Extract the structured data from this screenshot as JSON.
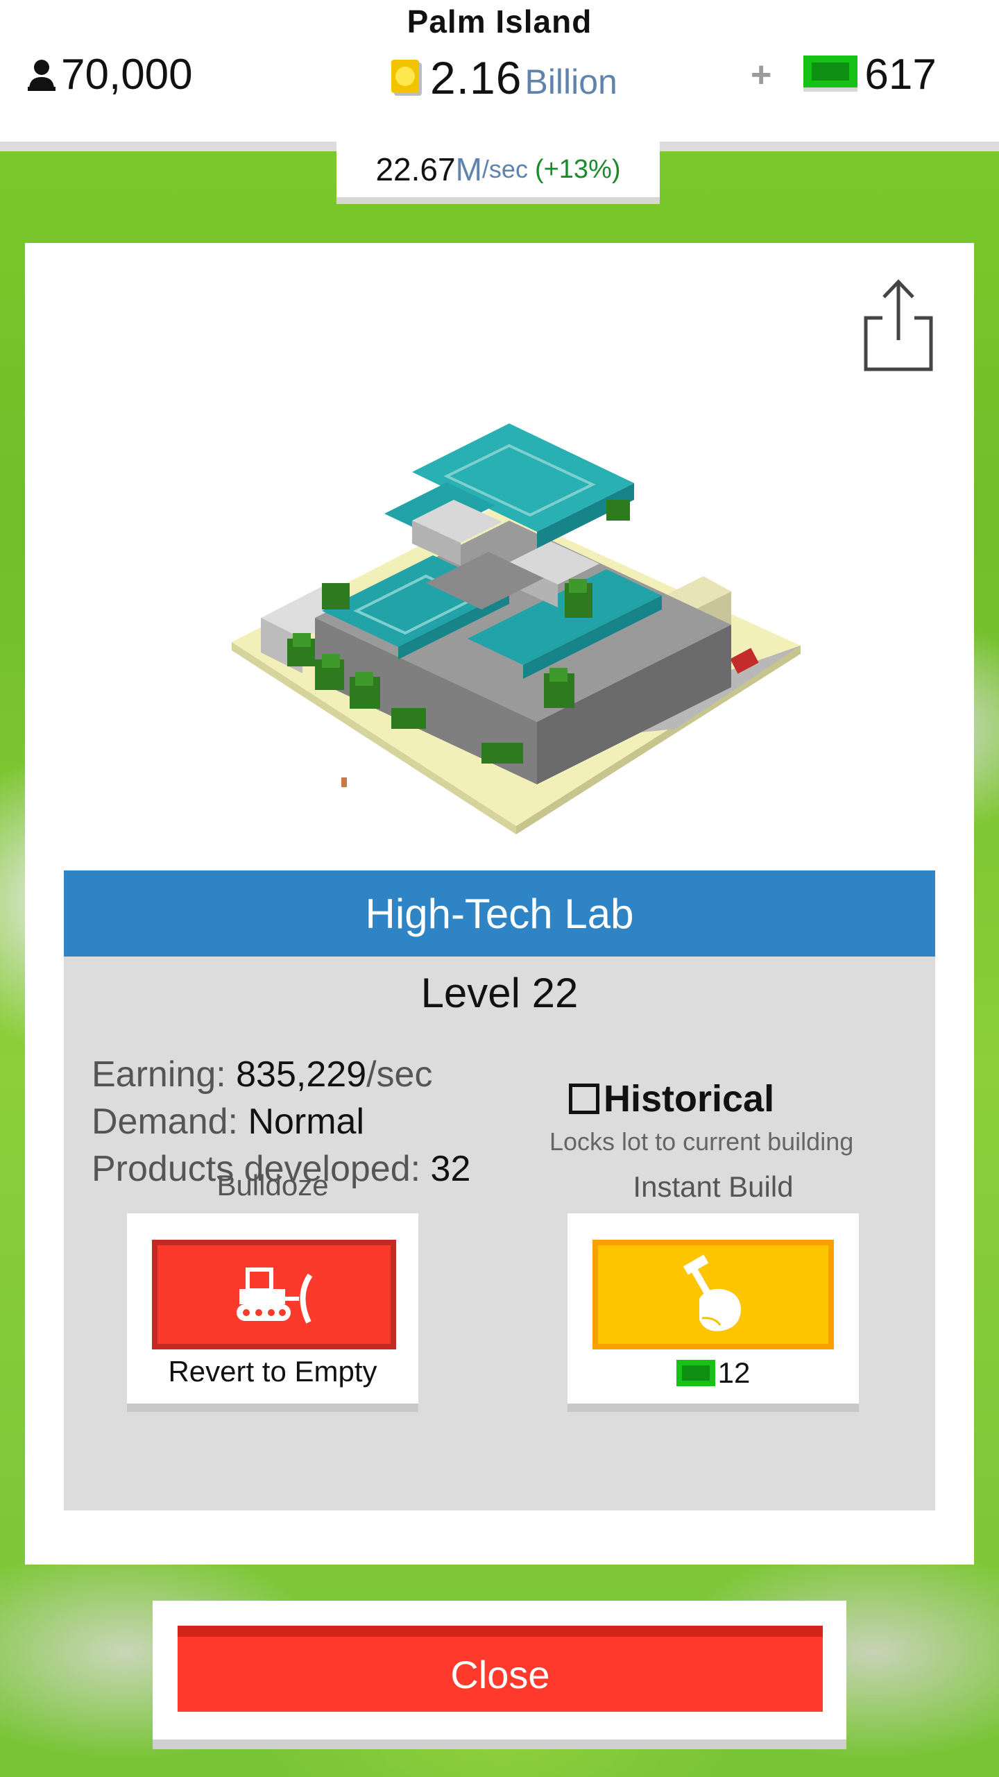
{
  "header": {
    "city_name": "Palm Island",
    "population": "70,000",
    "money_value": "2.16",
    "money_unit": "Billion",
    "plus": "+",
    "premium_currency": "617"
  },
  "rate": {
    "value": "22.67",
    "unit": "M",
    "per": "/sec",
    "bonus": "(+13%)"
  },
  "building": {
    "name": "High-Tech Lab",
    "level": "Level 22",
    "earning_label": "Earning: ",
    "earning_value": "835,229",
    "earning_suffix": "/sec",
    "demand_label": "Demand: ",
    "demand_value": "Normal",
    "products_label": "Products developed: ",
    "products_value": "32"
  },
  "historical": {
    "label": "Historical",
    "description": "Locks lot to current building",
    "checked": false
  },
  "actions": {
    "bulldoze_title": "Bulldoze",
    "bulldoze_caption": "Revert to Empty",
    "instant_build_title": "Instant Build",
    "instant_build_cost": "12"
  },
  "footer": {
    "close_label": "Close"
  },
  "colors": {
    "title_bar": "#2e84c5",
    "bulldoze": "#fb3a2c",
    "instant_build": "#fdc400",
    "close": "#ff3a2c",
    "currency_green": "#17c217",
    "background_grass": "#7fcd2c"
  },
  "icons": [
    "person-icon",
    "coin-icon",
    "green-bill-icon",
    "share-icon",
    "bulldozer-icon",
    "hammer-hand-icon"
  ]
}
